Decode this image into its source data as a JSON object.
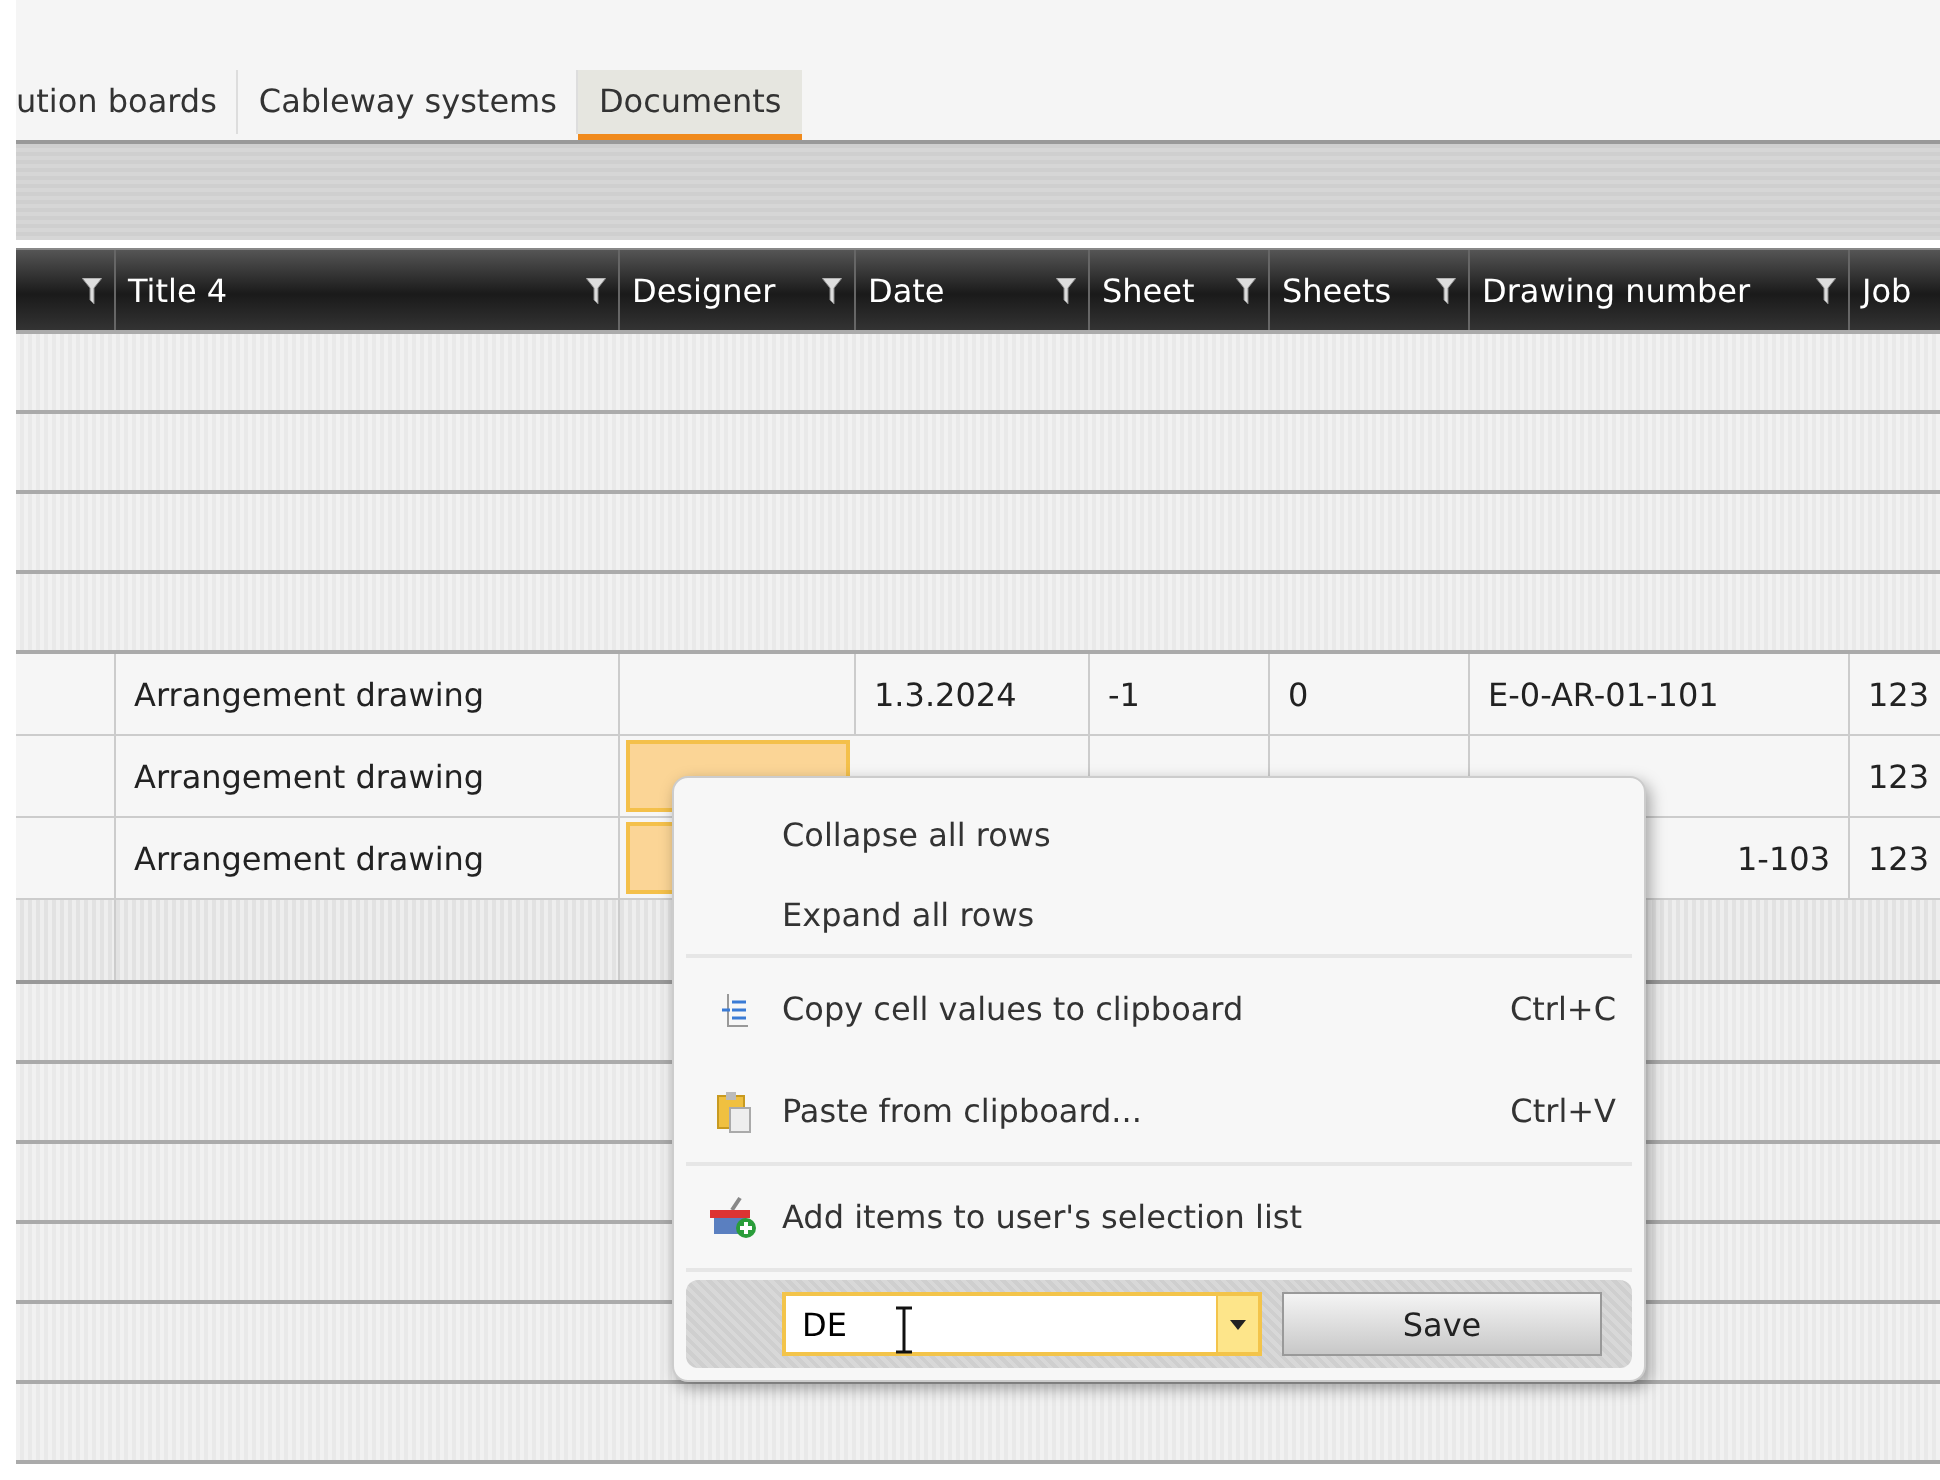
{
  "tabs": [
    {
      "label": "ution boards",
      "selected": false
    },
    {
      "label": "Cableway systems",
      "selected": false
    },
    {
      "label": "Documents",
      "selected": true
    }
  ],
  "table": {
    "columns": [
      "Title 4",
      "Designer",
      "Date",
      "Sheet",
      "Sheets",
      "Drawing number",
      "Job"
    ],
    "rows": [
      {
        "cells": [
          "Arrangement drawing",
          null,
          "1.3.2024",
          "-1",
          "0",
          "E-0-AR-01-101",
          "123"
        ],
        "designer_selected": false
      },
      {
        "cells": [
          "Arrangement drawing",
          null,
          null,
          null,
          null,
          null,
          "123"
        ],
        "designer_selected": true
      },
      {
        "cells": [
          "Arrangement drawing",
          null,
          null,
          null,
          null,
          "1-103",
          "123"
        ],
        "designer_selected": true
      }
    ]
  },
  "context_menu": {
    "items": [
      {
        "label": "Collapse all rows",
        "separator_after": false
      },
      {
        "label": "Expand all rows",
        "separator_after": true
      },
      {
        "label": "Copy cell values to clipboard",
        "shortcut": "Ctrl+C",
        "separator_after": false
      },
      {
        "label": "Paste from clipboard...",
        "shortcut": "Ctrl+V",
        "separator_after": true
      },
      {
        "label": "Add items to user's selection list",
        "separator_after": true
      }
    ],
    "combo": {
      "value": "DE"
    },
    "save_button": "Save"
  }
}
